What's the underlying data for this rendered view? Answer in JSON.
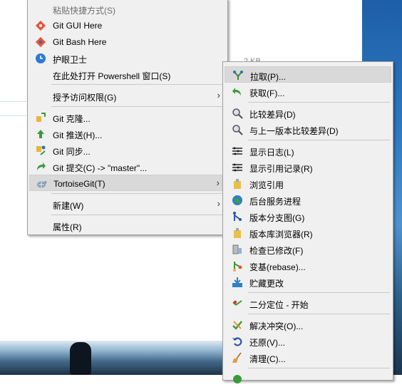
{
  "background": {
    "partial_text": "2 KB"
  },
  "main_menu": {
    "items": [
      {
        "label": "粘贴快捷方式(S)",
        "icon": "none",
        "dim": true
      },
      {
        "label": "Git GUI Here",
        "icon": "git-gui-icon"
      },
      {
        "label": "Git Bash Here",
        "icon": "git-bash-icon"
      },
      {
        "label": "护眼卫士",
        "icon": "eye-guard-icon"
      },
      {
        "label": "在此处打开 Powershell 窗口(S)",
        "icon": "none"
      },
      {
        "label": "授予访问权限(G)",
        "icon": "none",
        "submenu": true
      },
      {
        "label": "Git 克隆...",
        "icon": "git-clone-icon"
      },
      {
        "label": "Git 推送(H)...",
        "icon": "git-push-icon"
      },
      {
        "label": "Git 同步...",
        "icon": "git-sync-icon"
      },
      {
        "label": "Git 提交(C) -> \"master\"...",
        "icon": "git-commit-icon"
      },
      {
        "label": "TortoiseGit(T)",
        "icon": "tortoisegit-icon",
        "submenu": true,
        "highlighted": true
      },
      {
        "label": "新建(W)",
        "icon": "none",
        "submenu": true
      },
      {
        "label": "属性(R)",
        "icon": "none"
      }
    ]
  },
  "sub_menu": {
    "items": [
      {
        "label": "拉取(P)...",
        "icon": "pull-icon",
        "highlighted": true
      },
      {
        "label": "获取(F)...",
        "icon": "fetch-icon"
      },
      {
        "label": "比较差异(D)",
        "icon": "diff-icon"
      },
      {
        "label": "与上一版本比较差异(D)",
        "icon": "diff-previous-icon"
      },
      {
        "label": "显示日志(L)",
        "icon": "log-icon"
      },
      {
        "label": "显示引用记录(R)",
        "icon": "reflog-icon"
      },
      {
        "label": "浏览引用",
        "icon": "browse-refs-icon"
      },
      {
        "label": "后台服务进程",
        "icon": "daemon-icon"
      },
      {
        "label": "版本分支图(G)",
        "icon": "revision-graph-icon"
      },
      {
        "label": "版本库浏览器(R)",
        "icon": "repo-browser-icon"
      },
      {
        "label": "检查已修改(F)",
        "icon": "check-modifications-icon"
      },
      {
        "label": "变基(rebase)...",
        "icon": "rebase-icon"
      },
      {
        "label": "贮藏更改",
        "icon": "stash-icon"
      },
      {
        "label": "二分定位 - 开始",
        "icon": "bisect-icon"
      },
      {
        "label": "解决冲突(O)...",
        "icon": "resolve-icon"
      },
      {
        "label": "还原(V)...",
        "icon": "revert-icon"
      },
      {
        "label": "清理(C)...",
        "icon": "cleanup-icon"
      }
    ]
  }
}
